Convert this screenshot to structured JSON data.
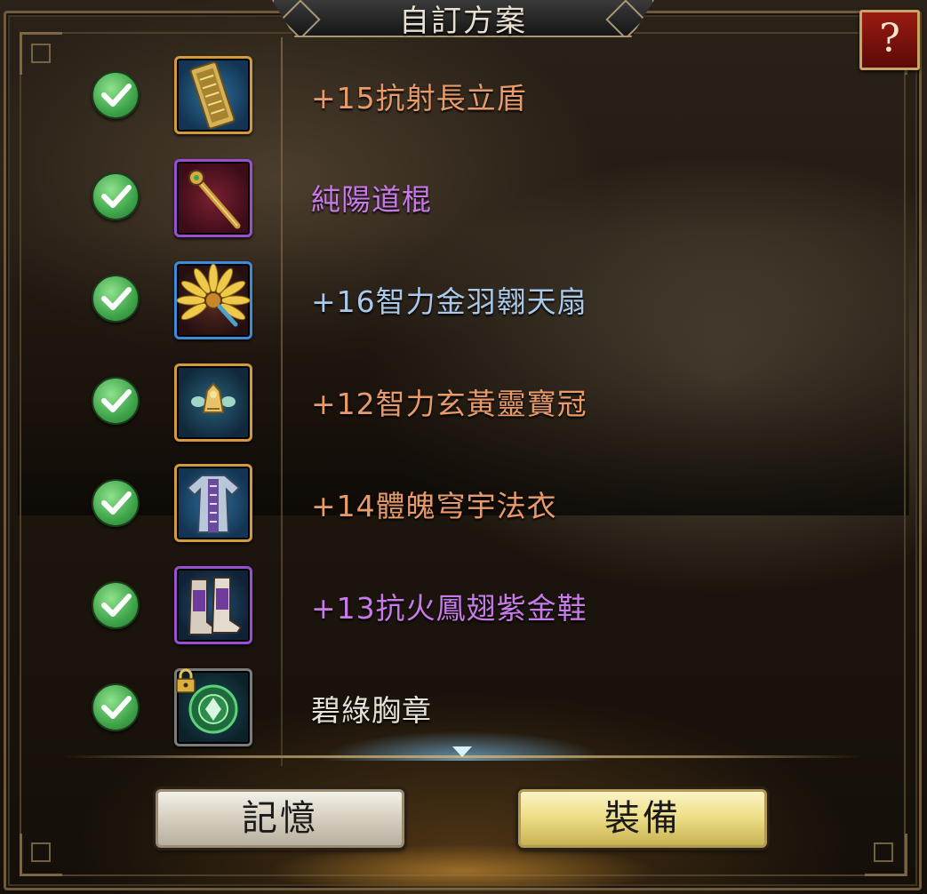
{
  "title": "自訂方案",
  "help_label": "?",
  "items": [
    {
      "name": "+15抗射長立盾",
      "checked": true,
      "rarity_color": "#e89a6a",
      "icon": "shield-icon"
    },
    {
      "name": "純陽道棍",
      "checked": true,
      "rarity_color": "#c77ae8",
      "icon": "staff-icon"
    },
    {
      "name": "+16智力金羽翱天扇",
      "checked": true,
      "rarity_color": "#a9c8ea",
      "icon": "feather-fan-icon"
    },
    {
      "name": "+12智力玄黃靈寶冠",
      "checked": true,
      "rarity_color": "#e89a6a",
      "icon": "crown-icon"
    },
    {
      "name": "+14體魄穹宇法衣",
      "checked": true,
      "rarity_color": "#e89a6a",
      "icon": "robe-icon"
    },
    {
      "name": "+13抗火鳳翅紫金鞋",
      "checked": true,
      "rarity_color": "#c77ae8",
      "icon": "boots-icon"
    },
    {
      "name": "碧綠胸章",
      "checked": true,
      "rarity_color": "#e6e2d6",
      "icon": "badge-icon",
      "locked": true
    }
  ],
  "buttons": {
    "memory_label": "記憶",
    "equip_label": "裝備"
  }
}
